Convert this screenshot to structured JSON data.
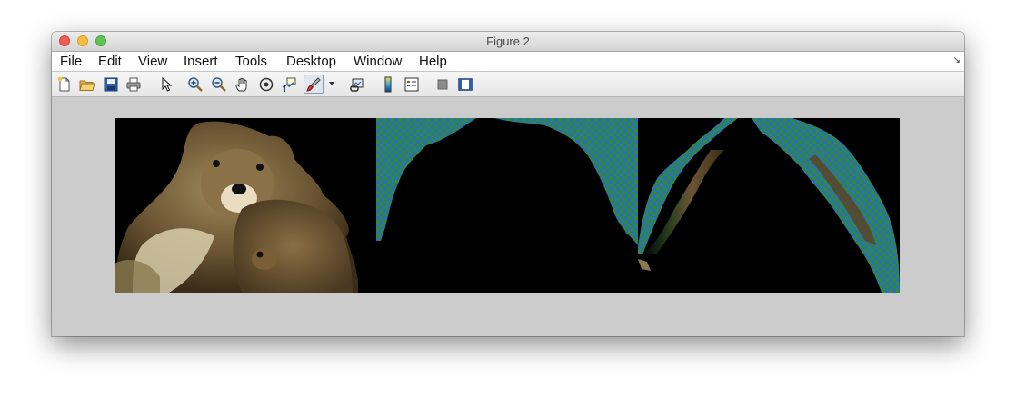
{
  "window": {
    "title": "Figure 2"
  },
  "menu": [
    "File",
    "Edit",
    "View",
    "Insert",
    "Tools",
    "Desktop",
    "Window",
    "Help"
  ],
  "toolbar": [
    "new-figure-icon",
    "open-file-icon",
    "save-icon",
    "print-icon",
    "pointer-icon",
    "zoom-in-icon",
    "zoom-out-icon",
    "pan-hand-icon",
    "rotate-3d-icon",
    "data-cursor-icon",
    "brush-icon",
    "brush-dropdown-icon",
    "link-plot-icon",
    "colorbar-icon",
    "legend-icon",
    "hide-plot-tools-icon",
    "show-plot-tools-icon"
  ],
  "colors": {
    "window_bg": "#cccccc",
    "checker_blue": "#2b6fb5",
    "checker_green": "#2f8a3e",
    "fur_brown": "#6b5533"
  },
  "images": [
    {
      "name": "segment-1",
      "content": "teddy bear foreground segment"
    },
    {
      "name": "segment-2",
      "content": "background segment (top region)"
    },
    {
      "name": "segment-3",
      "content": "edge / boundary segment"
    }
  ]
}
